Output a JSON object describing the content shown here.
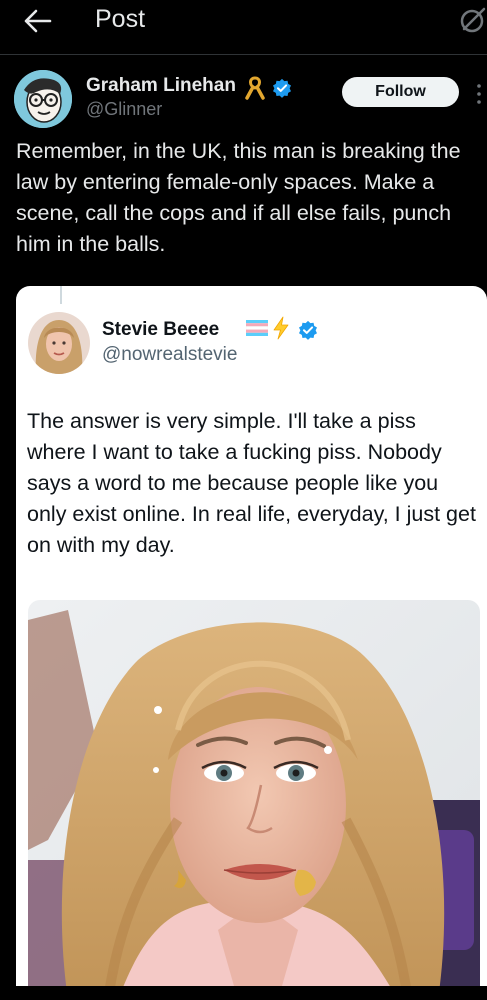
{
  "header": {
    "title": "Post"
  },
  "post": {
    "author_name": "Graham Linehan",
    "handle": "@Glinner",
    "follow_label": "Follow",
    "text": "Remember, in the UK, this man is breaking the law by entering female-only spaces. Make a scene, call the cops and if all else fails, punch him in the balls."
  },
  "quoted_post": {
    "author_name": "Stevie Beeee",
    "handle": "@nowrealstevie",
    "text": "The answer is very simple. I'll take a piss where I want to take a fucking piss. Nobody says a word to me because people like you only exist online. In real life, everyday, I just get on with my day."
  },
  "colors": {
    "background": "#000000",
    "verified": "#1d9bf0",
    "text_primary": "#e7e9ea",
    "text_secondary": "#71767b",
    "follow_bg": "#eff3f4"
  },
  "icons": {
    "back": "arrow-left-icon",
    "grok": "grok-icon",
    "ribbon": "awareness-ribbon-icon",
    "verified": "verified-badge-icon",
    "flag": "transgender-flag-icon",
    "bolt": "lightning-bolt-icon",
    "more": "more-vertical-icon"
  }
}
